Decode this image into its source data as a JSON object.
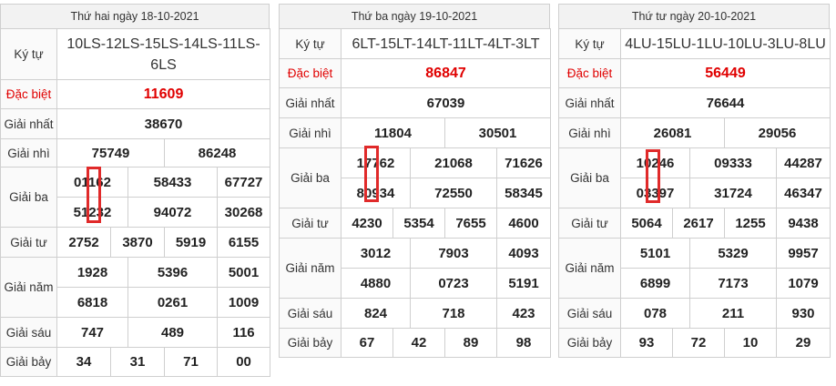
{
  "panels": [
    {
      "date": "Thứ hai ngày 18-10-2021",
      "ky_tu": "10LS-12LS-15LS-14LS-11LS-6LS",
      "dac_biet": "11609",
      "nhat": "38670",
      "nhi": [
        "75749",
        "86248"
      ],
      "ba": [
        "01162",
        "58433",
        "67727",
        "51232",
        "94072",
        "30268"
      ],
      "tu": [
        "2752",
        "3870",
        "5919",
        "6155"
      ],
      "nam": [
        "1928",
        "5396",
        "5001",
        "6818",
        "0261",
        "1009"
      ],
      "sau": [
        "747",
        "489",
        "116"
      ],
      "bay": [
        "34",
        "31",
        "71",
        "00"
      ]
    },
    {
      "date": "Thứ ba ngày 19-10-2021",
      "ky_tu": "6LT-15LT-14LT-11LT-4LT-3LT",
      "dac_biet": "86847",
      "nhat": "67039",
      "nhi": [
        "11804",
        "30501"
      ],
      "ba": [
        "17762",
        "21068",
        "71626",
        "80934",
        "72550",
        "58345"
      ],
      "tu": [
        "4230",
        "5354",
        "7655",
        "4600"
      ],
      "nam": [
        "3012",
        "7903",
        "4093",
        "4880",
        "0723",
        "5191"
      ],
      "sau": [
        "824",
        "718",
        "423"
      ],
      "bay": [
        "67",
        "42",
        "89",
        "98"
      ]
    },
    {
      "date": "Thứ tư ngày 20-10-2021",
      "ky_tu": "4LU-15LU-1LU-10LU-3LU-8LU",
      "dac_biet": "56449",
      "nhat": "76644",
      "nhi": [
        "26081",
        "29056"
      ],
      "ba": [
        "10246",
        "09333",
        "44287",
        "03397",
        "31724",
        "46347"
      ],
      "tu": [
        "5064",
        "2617",
        "1255",
        "9438"
      ],
      "nam": [
        "5101",
        "5329",
        "9957",
        "6899",
        "7173",
        "1079"
      ],
      "sau": [
        "078",
        "211",
        "930"
      ],
      "bay": [
        "93",
        "72",
        "10",
        "29"
      ]
    }
  ],
  "labels": {
    "ky_tu": "Ký tự",
    "dac_biet": "Đặc biệt",
    "nhat": "Giải nhất",
    "nhi": "Giải nhì",
    "ba": "Giải ba",
    "tu": "Giải tư",
    "nam": "Giải năm",
    "sau": "Giải sáu",
    "bay": "Giải bảy"
  },
  "colors": {
    "special": "#e00000",
    "highlight_box": "#e02a2a",
    "header_bg": "#f2f2f2",
    "border": "#cfcfcf"
  }
}
